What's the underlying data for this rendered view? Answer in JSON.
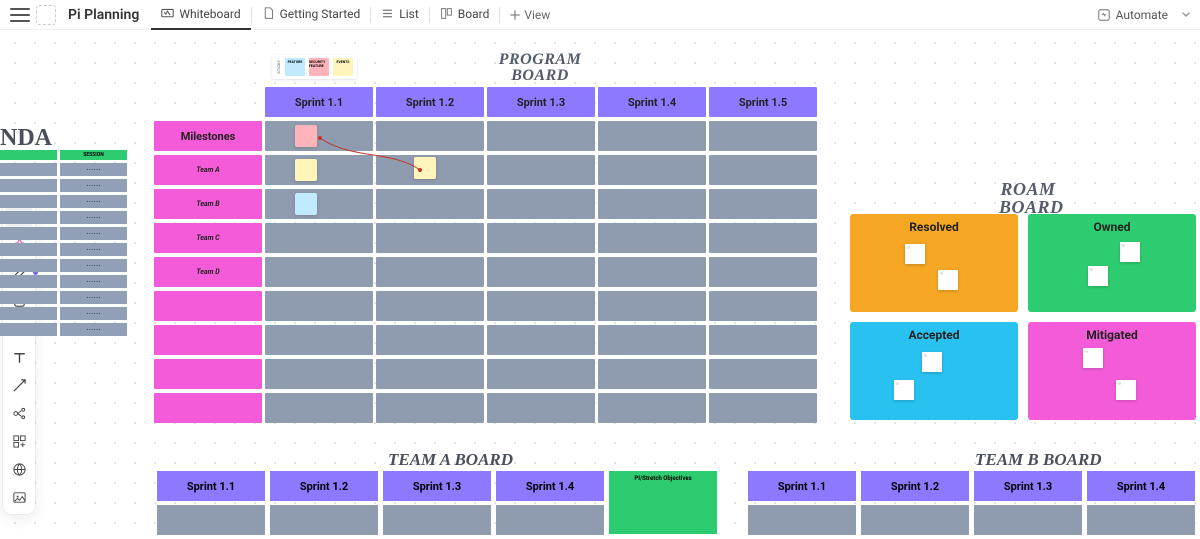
{
  "header": {
    "doc_title": "Pi Planning",
    "tabs": {
      "whiteboard": "Whiteboard",
      "getting_started": "Getting Started",
      "list": "List",
      "board": "Board"
    },
    "view": "View",
    "automate": "Automate"
  },
  "program_board": {
    "title1": "PROGRAM",
    "title2": "BOARD",
    "legend": {
      "l1": "FEATURE",
      "l2": "SECURITY FEATURE",
      "l3": "EVENTS",
      "sticky": "STICKY"
    },
    "cols": [
      "Sprint 1.1",
      "Sprint 1.2",
      "Sprint 1.3",
      "Sprint 1.4",
      "Sprint 1.5"
    ],
    "row_heads": [
      "Milestones",
      "Team A",
      "Team B",
      "Team C",
      "Team D"
    ],
    "row_extra": [
      "",
      "",
      ""
    ]
  },
  "agenda": {
    "title": "NDA",
    "col2": "SESSION"
  },
  "roam": {
    "title1": "ROAM",
    "title2": "BOARD",
    "cards": [
      "Resolved",
      "Owned",
      "Accepted",
      "Mitigated"
    ]
  },
  "team_a": {
    "title": "TEAM A BOARD",
    "cols": [
      "Sprint 1.1",
      "Sprint 1.2",
      "Sprint 1.3",
      "Sprint 1.4"
    ],
    "obj": "PI/Stretch Objectives"
  },
  "team_b": {
    "title": "TEAM B BOARD",
    "cols": [
      "Sprint 1.1",
      "Sprint 1.2",
      "Sprint 1.3",
      "Sprint 1.4"
    ]
  }
}
